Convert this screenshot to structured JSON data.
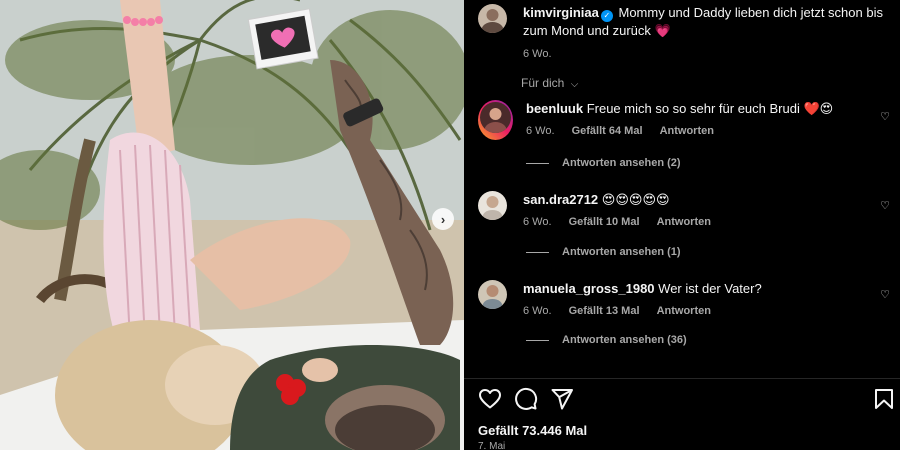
{
  "post": {
    "author": "kimvirginiaa",
    "caption": "Mommy und Daddy lieben dich jetzt schon bis zum Mond und zurück 💗",
    "age": "6 Wo.",
    "translate_label": "Für dich",
    "likes": "Gefällt 73.446 Mal",
    "date": "7. Mai"
  },
  "comments": [
    {
      "user": "beenluuk",
      "text": "Freue mich so so sehr für euch Brudi ❤️😍",
      "age": "6 Wo.",
      "likes": "Gefällt 64 Mal",
      "reply": "Antworten",
      "view_replies": "Antworten ansehen (2)"
    },
    {
      "user": "san.dra2712",
      "text": "😍😍😍😍😍",
      "age": "6 Wo.",
      "likes": "Gefällt 10 Mal",
      "reply": "Antworten",
      "view_replies": "Antworten ansehen (1)"
    },
    {
      "user": "manuela_gross_1980",
      "text": "Wer ist der Vater?",
      "age": "6 Wo.",
      "likes": "Gefällt 13 Mal",
      "reply": "Antworten",
      "view_replies": "Antworten ansehen (36)"
    }
  ],
  "icons": {
    "like": "heart-outline-icon",
    "comment": "speech-bubble-icon",
    "share": "paper-plane-icon",
    "save": "bookmark-icon",
    "next": "chevron-right-icon",
    "comment_like": "small-heart-icon"
  },
  "colors": {
    "background": "#000000",
    "text": "#f5f5f5",
    "muted": "#a8a8a8",
    "verified": "#0095f6"
  }
}
